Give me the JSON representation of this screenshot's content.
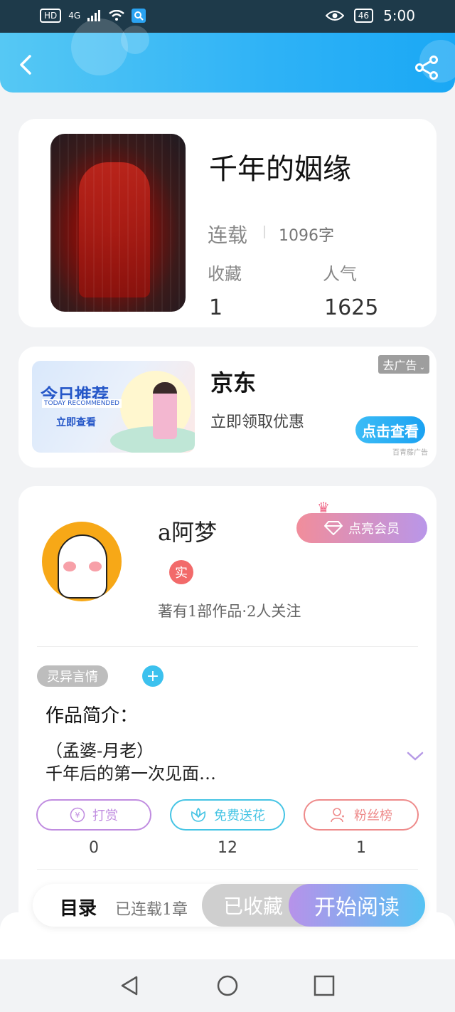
{
  "status_bar": {
    "hd": "HD",
    "network": "4G",
    "battery": "46",
    "time": "5:00"
  },
  "book": {
    "title": "千年的姻缘",
    "status": "连载",
    "word_count": "1096字",
    "favorites_label": "收藏",
    "favorites_value": "1",
    "popularity_label": "人气",
    "popularity_value": "1625"
  },
  "ad": {
    "image_title": "今日推荐",
    "image_subtitle": "TODAY RECOMMENDED",
    "image_cta": "立即查看",
    "title": "京东",
    "description": "立即领取优惠",
    "remove_label": "去广告",
    "cta_label": "点击查看",
    "source": "百青藤广告"
  },
  "author": {
    "name": "a阿梦",
    "verified_badge": "实",
    "member_button": "点亮会员",
    "stats": "著有1部作品·2人关注"
  },
  "intro": {
    "tag": "灵异言情",
    "label": "作品简介：",
    "line1": "（孟婆-月老）",
    "line2": "千年后的第一次见面…"
  },
  "actions": [
    {
      "label": "打赏",
      "icon": "yen-icon",
      "count": "0",
      "color": "#c08ce0"
    },
    {
      "label": "免费送花",
      "icon": "flower-icon",
      "count": "12",
      "color": "#45c4e4"
    },
    {
      "label": "粉丝榜",
      "icon": "fans-icon",
      "count": "1",
      "color": "#ee8a8a"
    }
  ],
  "bottom_bar": {
    "toc_label": "目录",
    "toc_status": "已连载1章",
    "collected_label": "已收藏",
    "read_label": "开始阅读"
  },
  "colors": {
    "header_gradient_start": "#56c8f4",
    "header_gradient_end": "#1aa8f5",
    "read_gradient_start": "#b792ea",
    "read_gradient_end": "#56c3f3"
  }
}
